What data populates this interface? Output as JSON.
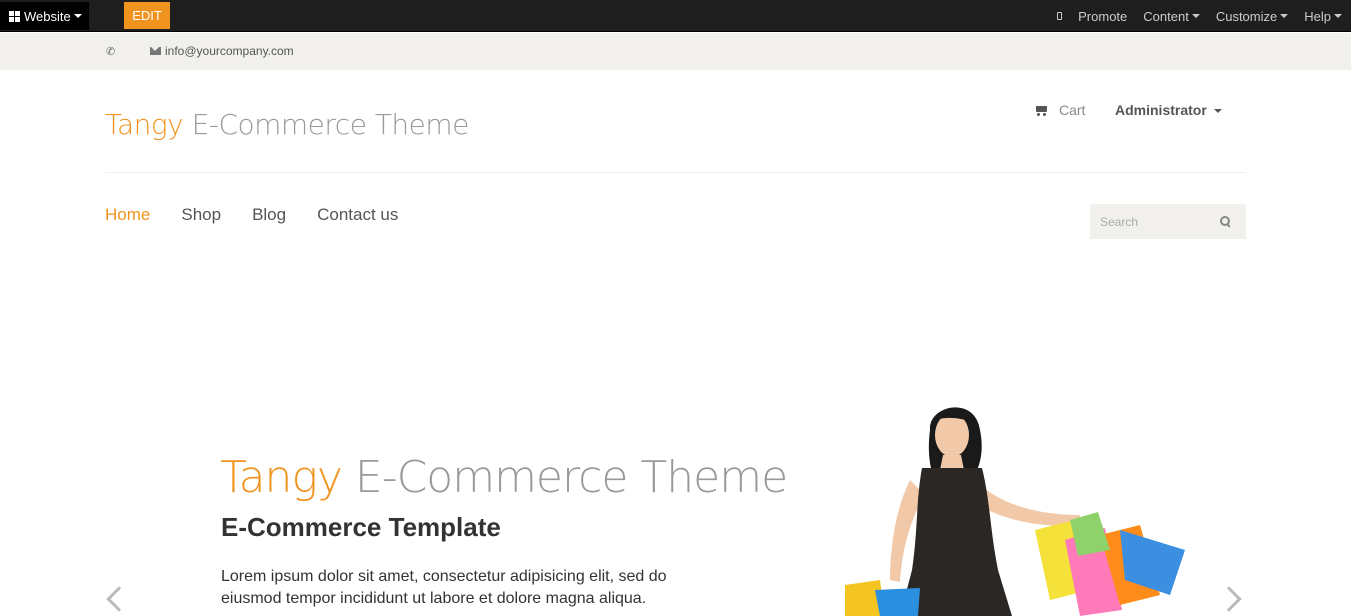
{
  "adminbar": {
    "website_label": "Website",
    "edit_label": "EDIT",
    "promote_label": "Promote",
    "content_label": "Content",
    "customize_label": "Customize",
    "help_label": "Help"
  },
  "contact": {
    "email": "info@yourcompany.com"
  },
  "header": {
    "logo_accent": "Tangy",
    "logo_rest": "E-Commerce Theme",
    "cart_label": "Cart",
    "user_label": "Administrator"
  },
  "nav": {
    "items": [
      {
        "label": "Home",
        "active": true
      },
      {
        "label": "Shop"
      },
      {
        "label": "Blog"
      },
      {
        "label": "Contact us"
      }
    ],
    "search_placeholder": "Search"
  },
  "hero": {
    "title_accent": "Tangy",
    "title_rest": "E-Commerce Theme",
    "subtitle": "E-Commerce Template",
    "text": "Lorem ipsum dolor sit amet, consectetur adipisicing elit, sed do eiusmod tempor incididunt ut labore et dolore magna aliqua."
  },
  "colors": {
    "accent": "#f0931f",
    "adminbar_bg": "#1e1e1e",
    "contactbar_bg": "#f1f0ec"
  }
}
